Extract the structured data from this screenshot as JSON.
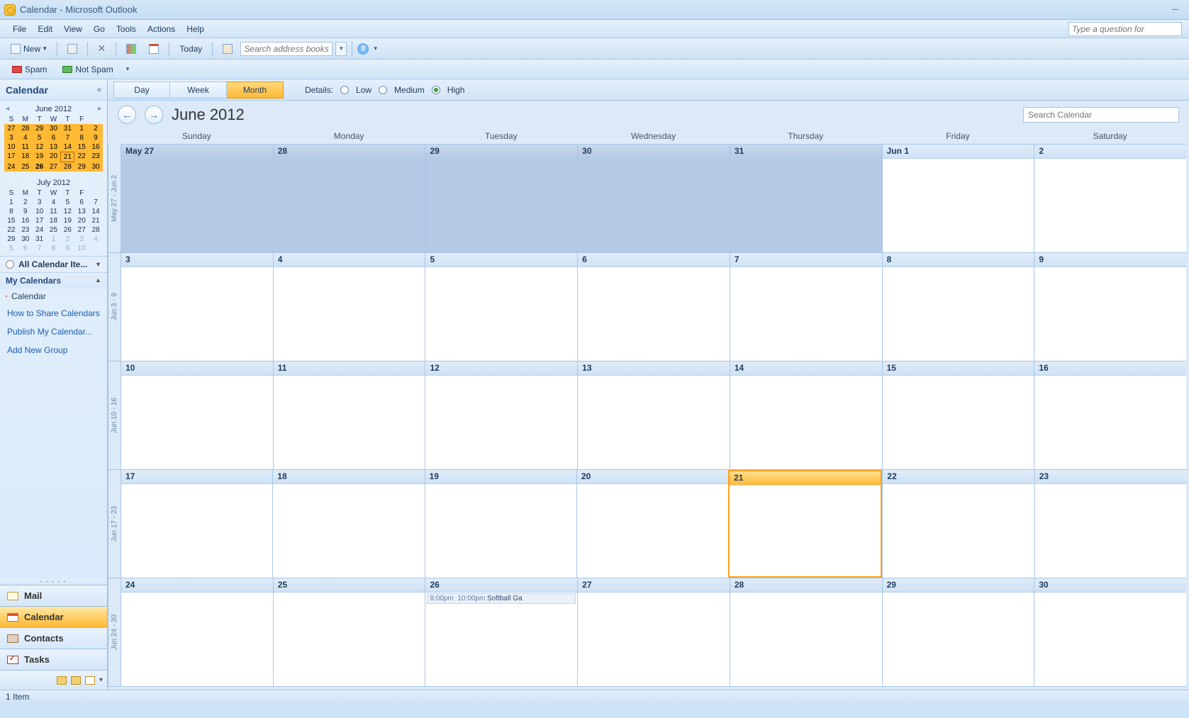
{
  "window": {
    "title": "Calendar - Microsoft Outlook"
  },
  "menu": {
    "file": "File",
    "edit": "Edit",
    "view": "View",
    "go": "Go",
    "tools": "Tools",
    "actions": "Actions",
    "help": "Help",
    "help_placeholder": "Type a question for"
  },
  "toolbar": {
    "new": "New",
    "today": "Today",
    "search_ab_placeholder": "Search address books"
  },
  "spam": {
    "spam": "Spam",
    "notspam": "Not Spam"
  },
  "sidebar": {
    "title": "Calendar",
    "minical1": {
      "title": "June 2012",
      "dh": [
        "S",
        "M",
        "T",
        "W",
        "T",
        "F"
      ]
    },
    "minical2": {
      "title": "July 2012",
      "dh": [
        "S",
        "M",
        "T",
        "W",
        "T",
        "F"
      ]
    },
    "allcal": "All Calendar Ite...",
    "mycal": "My Calendars",
    "cal_item": "Calendar",
    "link_share": "How to Share Calendars",
    "link_publish": "Publish My Calendar...",
    "link_addgroup": "Add New Group",
    "nav": {
      "mail": "Mail",
      "calendar": "Calendar",
      "contacts": "Contacts",
      "tasks": "Tasks"
    }
  },
  "viewbar": {
    "day": "Day",
    "week": "Week",
    "month": "Month",
    "details": "Details:",
    "low": "Low",
    "medium": "Medium",
    "high": "High"
  },
  "header": {
    "title": "June 2012",
    "search_placeholder": "Search Calendar"
  },
  "dayheaders": [
    "Sunday",
    "Monday",
    "Tuesday",
    "Wednesday",
    "Thursday",
    "Friday",
    "Saturday"
  ],
  "weeks": [
    {
      "gutter": "May 27 - Jun 2",
      "days": [
        {
          "label": "May 27",
          "prev": true
        },
        {
          "label": "28",
          "prev": true
        },
        {
          "label": "29",
          "prev": true
        },
        {
          "label": "30",
          "prev": true
        },
        {
          "label": "31",
          "prev": true
        },
        {
          "label": "Jun 1"
        },
        {
          "label": "2"
        }
      ]
    },
    {
      "gutter": "Jun 3 - 9",
      "days": [
        {
          "label": "3"
        },
        {
          "label": "4"
        },
        {
          "label": "5"
        },
        {
          "label": "6"
        },
        {
          "label": "7"
        },
        {
          "label": "8"
        },
        {
          "label": "9"
        }
      ]
    },
    {
      "gutter": "Jun 10 - 16",
      "days": [
        {
          "label": "10"
        },
        {
          "label": "11"
        },
        {
          "label": "12"
        },
        {
          "label": "13"
        },
        {
          "label": "14"
        },
        {
          "label": "15"
        },
        {
          "label": "16"
        }
      ]
    },
    {
      "gutter": "Jun 17 - 23",
      "days": [
        {
          "label": "17"
        },
        {
          "label": "18"
        },
        {
          "label": "19"
        },
        {
          "label": "20"
        },
        {
          "label": "21",
          "today": true
        },
        {
          "label": "22"
        },
        {
          "label": "23"
        }
      ]
    },
    {
      "gutter": "Jun 24 - 30",
      "days": [
        {
          "label": "24"
        },
        {
          "label": "25"
        },
        {
          "label": "26",
          "events": [
            {
              "start": "8:00pm",
              "end": "10:00pm",
              "title": "Softball Ga"
            }
          ]
        },
        {
          "label": "27"
        },
        {
          "label": "28"
        },
        {
          "label": "29"
        },
        {
          "label": "30"
        }
      ]
    }
  ],
  "mc1_days": [
    {
      "d": "27",
      "hl": true
    },
    {
      "d": "28",
      "hl": true
    },
    {
      "d": "29",
      "hl": true
    },
    {
      "d": "30",
      "hl": true
    },
    {
      "d": "31",
      "hl": true
    },
    {
      "d": "1",
      "hl": true
    },
    {
      "d": "3",
      "hl": true
    },
    {
      "d": "4",
      "hl": true
    },
    {
      "d": "5",
      "hl": true
    },
    {
      "d": "6",
      "hl": true
    },
    {
      "d": "7",
      "hl": true
    },
    {
      "d": "8",
      "hl": true
    },
    {
      "d": "10",
      "hl": true
    },
    {
      "d": "11",
      "hl": true
    },
    {
      "d": "12",
      "hl": true
    },
    {
      "d": "13",
      "hl": true
    },
    {
      "d": "14",
      "hl": true
    },
    {
      "d": "15",
      "hl": true
    },
    {
      "d": "17",
      "hl": true
    },
    {
      "d": "18",
      "hl": true
    },
    {
      "d": "19",
      "hl": true
    },
    {
      "d": "20",
      "hl": true
    },
    {
      "d": "21",
      "hl": true,
      "today": true
    },
    {
      "d": "22",
      "hl": true
    },
    {
      "d": "24",
      "hl": true
    },
    {
      "d": "25",
      "hl": true
    },
    {
      "d": "26",
      "hl": true,
      "bold": true
    },
    {
      "d": "27",
      "hl": true
    },
    {
      "d": "28",
      "hl": true
    },
    {
      "d": "29",
      "hl": true
    }
  ],
  "mc1_extra": [
    {
      "d": "2",
      "hl": true
    },
    {
      "d": "9",
      "hl": true
    },
    {
      "d": "16",
      "hl": true
    },
    {
      "d": "23",
      "hl": true
    },
    {
      "d": "30",
      "hl": true
    }
  ],
  "mc2_rows": [
    [
      "1",
      "2",
      "3",
      "4",
      "5",
      "6"
    ],
    [
      "8",
      "9",
      "10",
      "11",
      "12",
      "13"
    ],
    [
      "15",
      "16",
      "17",
      "18",
      "19",
      "20"
    ],
    [
      "22",
      "23",
      "24",
      "25",
      "26",
      "27"
    ],
    [
      "29",
      "30",
      "31",
      "1",
      "2",
      "3"
    ],
    [
      "5",
      "6",
      "7",
      "8",
      "9",
      "10"
    ]
  ],
  "status": "1 Item"
}
